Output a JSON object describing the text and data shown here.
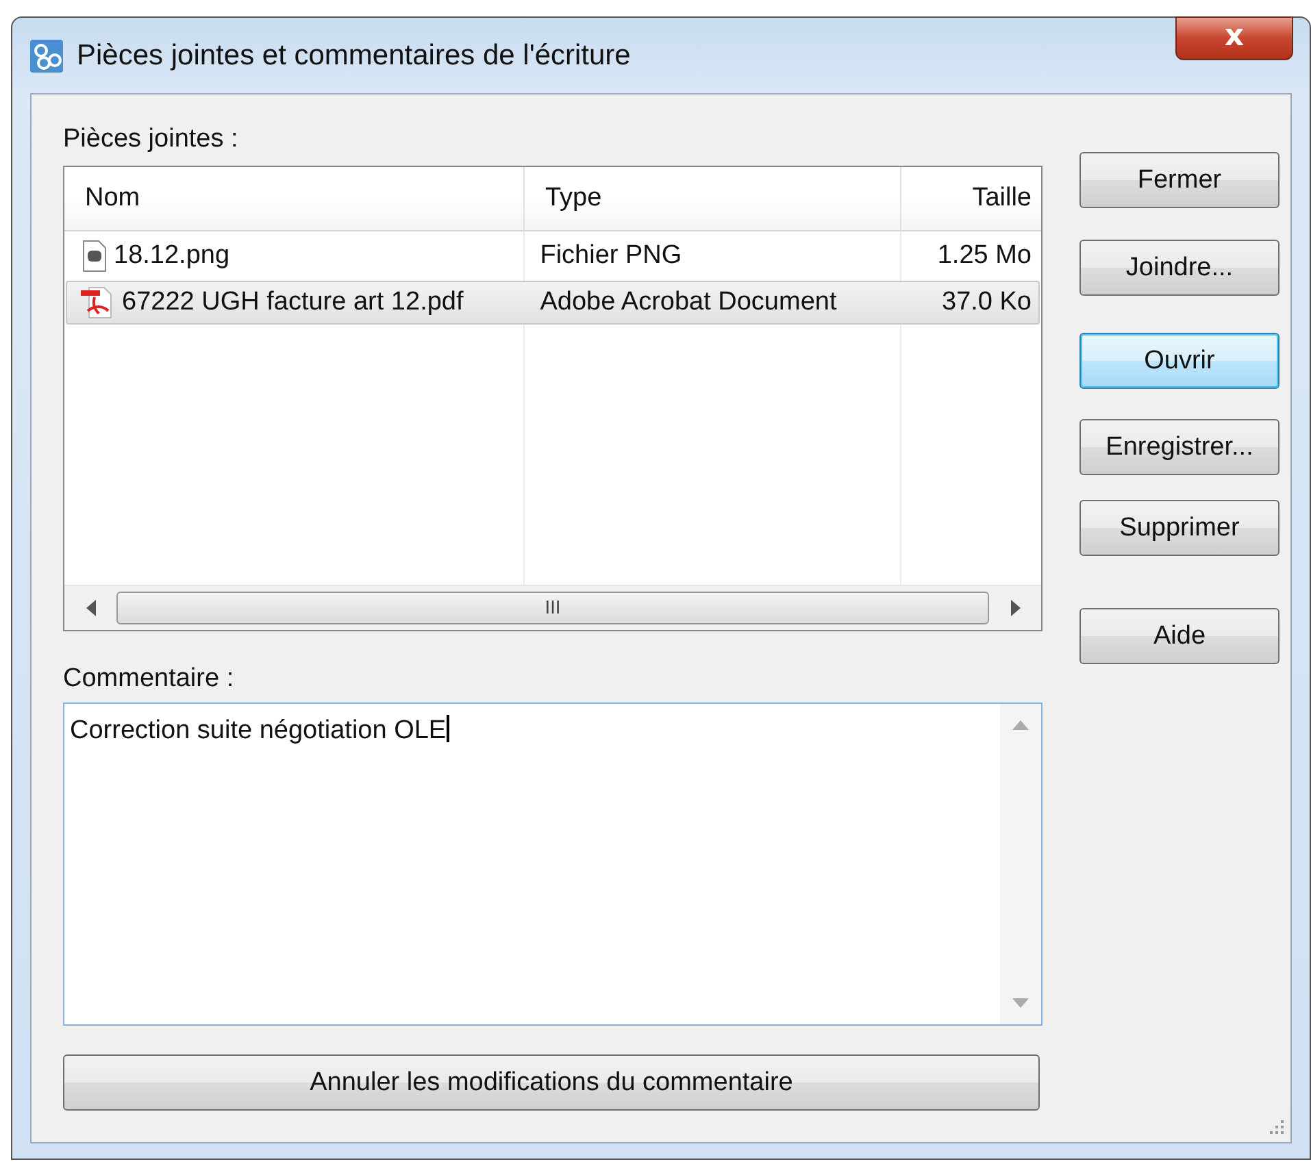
{
  "window": {
    "title": "Pièces jointes et commentaires de l'écriture",
    "close_symbol": "x"
  },
  "attachments": {
    "label": "Pièces jointes :",
    "columns": [
      "Nom",
      "Type",
      "Taille"
    ],
    "rows": [
      {
        "kind": "image",
        "name": "18.12.png",
        "type": "Fichier PNG",
        "size": "1.25 Mo",
        "selected": false
      },
      {
        "kind": "pdf",
        "name": "67222 UGH facture art 12.pdf",
        "type": "Adobe Acrobat Document",
        "size": "37.0 Ko",
        "selected": true
      }
    ],
    "scrollbar_grip": "III"
  },
  "comment": {
    "label": "Commentaire :",
    "value": "Correction suite négotiation OLE"
  },
  "reset_button": "Annuler les modifications du commentaire",
  "buttons": [
    {
      "label": "Fermer",
      "focused": false
    },
    {
      "label": "Joindre...",
      "focused": false
    },
    {
      "label": "Ouvrir",
      "focused": true
    },
    {
      "label": "Enregistrer...",
      "focused": false
    },
    {
      "label": "Supprimer",
      "focused": false
    },
    {
      "label": "Aide",
      "focused": false
    }
  ]
}
